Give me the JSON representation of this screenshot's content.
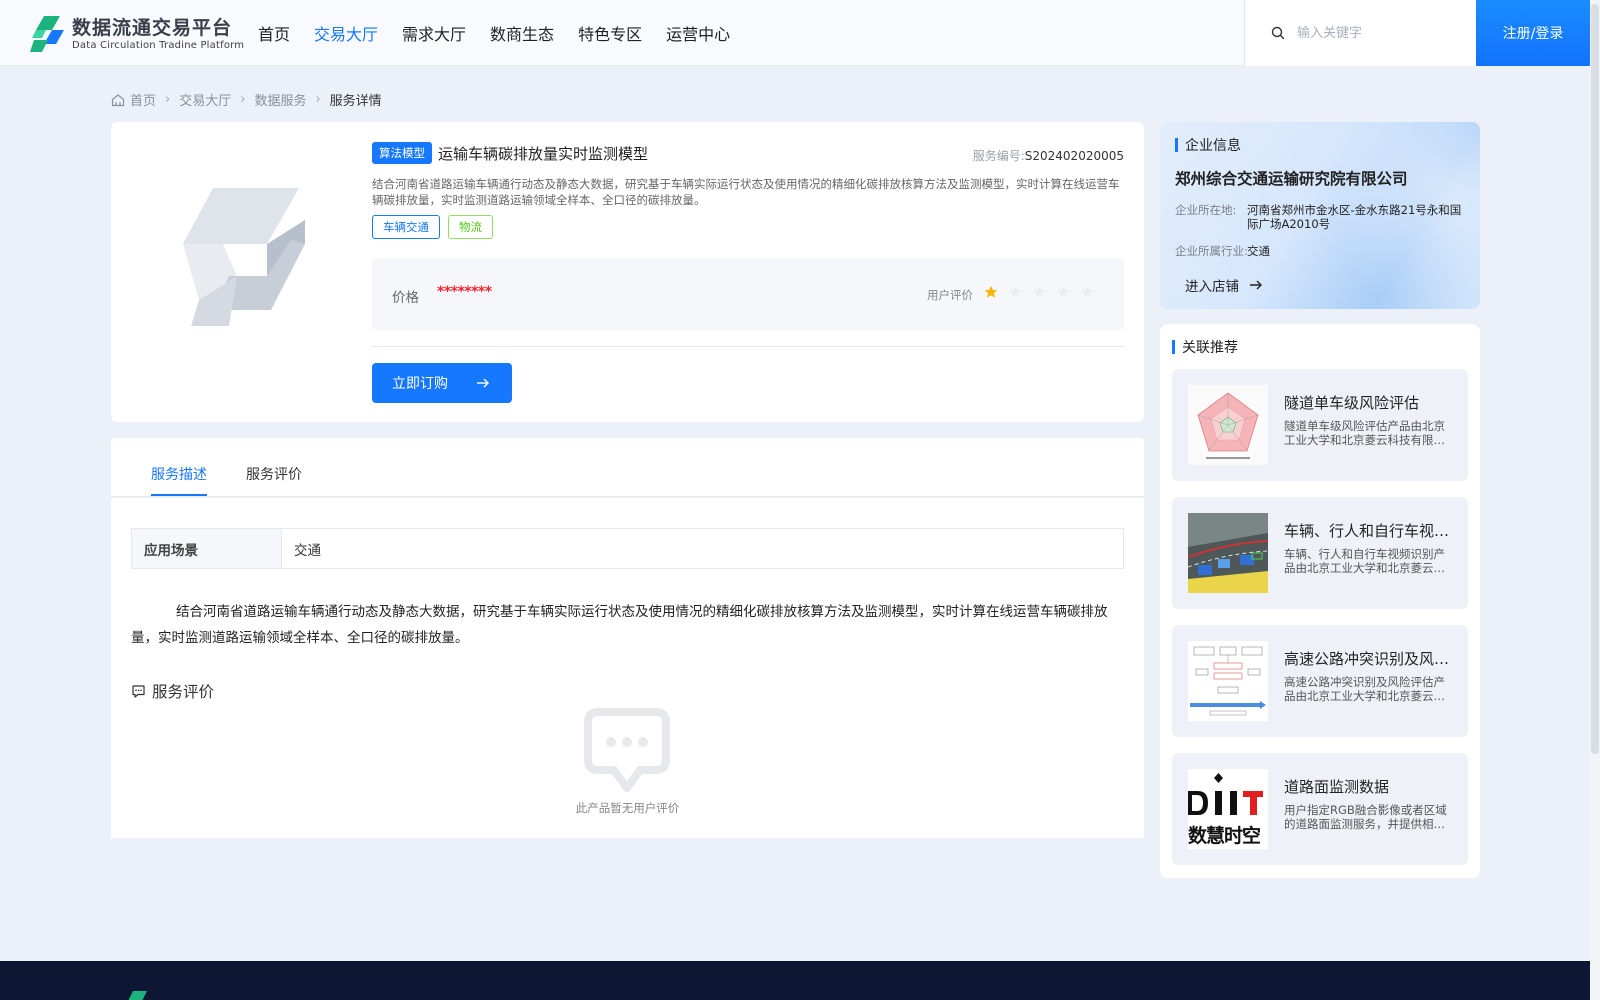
{
  "header": {
    "logo_title": "数据流通交易平台",
    "logo_subtitle": "Data Circulation Tradine Platform",
    "nav": [
      {
        "label": "首页"
      },
      {
        "label": "交易大厅",
        "active": true
      },
      {
        "label": "需求大厅"
      },
      {
        "label": "数商生态"
      },
      {
        "label": "特色专区"
      },
      {
        "label": "运营中心"
      }
    ],
    "search_placeholder": "输入关键字",
    "login_label": "注册/登录",
    "brand_color": "#1677ff"
  },
  "breadcrumb": {
    "items": [
      "首页",
      "交易大厅",
      "数据服务"
    ],
    "current": "服务详情"
  },
  "product": {
    "type_tag": "算法模型",
    "title": "运输车辆碳排放量实时监测模型",
    "service_no_label": "服务编号:",
    "service_no": "S202402020005",
    "description": "结合河南省道路运输车辆通行动态及静态大数据，研究基于车辆实际运行状态及使用情况的精细化碳排放核算方法及监测模型，实时计算在线运营车辆碳排放量，实时监测道路运输领域全样本、全口径的碳排放量。",
    "tags": [
      "车辆交通",
      "物流"
    ],
    "price_label": "价格",
    "price_value": "********",
    "rating_label": "用户评价",
    "rating": 1,
    "rating_max": 5,
    "buy_label": "立即订购"
  },
  "detail": {
    "tabs": [
      {
        "label": "服务描述",
        "active": true
      },
      {
        "label": "服务评价"
      }
    ],
    "scene_label": "应用场景",
    "scene_value": "交通",
    "long_description": "结合河南省道路运输车辆通行动态及静态大数据，研究基于车辆实际运行状态及使用情况的精细化碳排放核算方法及监测模型，实时计算在线运营车辆碳排放量，实时监测道路运输领域全样本、全口径的碳排放量。",
    "review_title": "服务评价",
    "empty_text": "此产品暂无用户评价"
  },
  "enterprise": {
    "section_title": "企业信息",
    "name": "郑州综合交通运输研究院有限公司",
    "location_label": "企业所在地:",
    "location": "河南省郑州市金水区-金水东路21号永和国际广场A2010号",
    "industry_label": "企业所属行业:",
    "industry": "交通",
    "shop_label": "进入店铺"
  },
  "recommend": {
    "section_title": "关联推荐",
    "items": [
      {
        "name": "隧道单车级风险评估",
        "desc": "隧道单车级风险评估产品由北京工业大学和北京菱云科技有限公司联合开发",
        "thumb": "radar-chart"
      },
      {
        "name": "车辆、行人和自行车视频识别",
        "desc": "车辆、行人和自行车视频识别产品由北京工业大学和北京菱云科技有限公司联合开发",
        "thumb": "road-photo"
      },
      {
        "name": "高速公路冲突识别及风险评估",
        "desc": "高速公路冲突识别及风险评估产品由北京工业大学和北京菱云科技有限公司联合开发",
        "thumb": "flow-diagram"
      },
      {
        "name": "道路面监测数据",
        "desc": "用户指定RGB融合影像或者区域的道路面监测服务，并提供相关数据",
        "thumb": "brand-logo",
        "logo_text": "数慧时空"
      }
    ]
  }
}
